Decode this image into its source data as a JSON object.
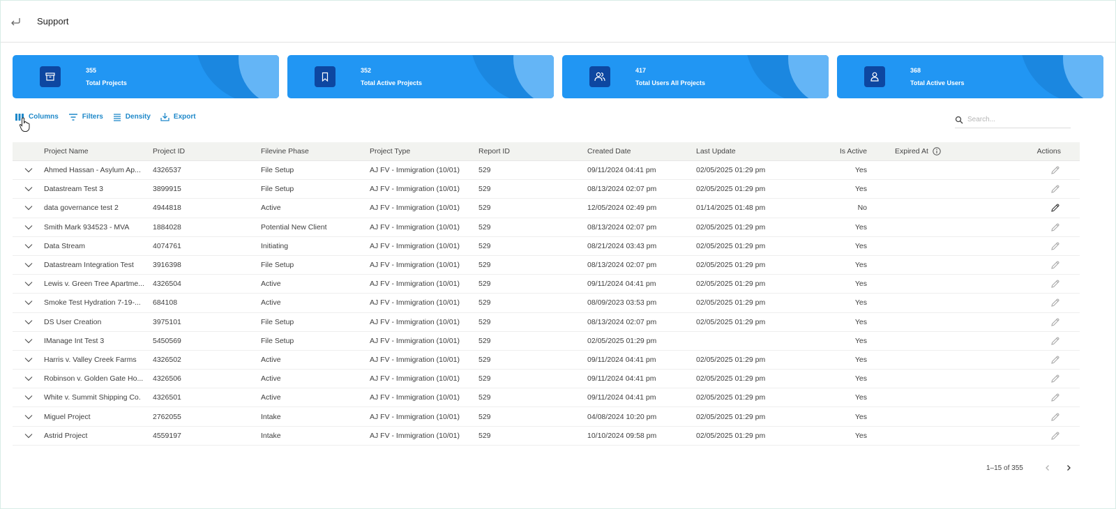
{
  "header": {
    "title": "Support"
  },
  "stats": [
    {
      "value": "355",
      "label": "Total Projects",
      "icon": "archive-icon"
    },
    {
      "value": "352",
      "label": "Total Active Projects",
      "icon": "bookmark-icon"
    },
    {
      "value": "417",
      "label": "Total Users All Projects",
      "icon": "users-icon"
    },
    {
      "value": "368",
      "label": "Total Active Users",
      "icon": "user-icon"
    }
  ],
  "toolbar": {
    "columns_label": "Columns",
    "filters_label": "Filters",
    "density_label": "Density",
    "export_label": "Export",
    "search_placeholder": "Search..."
  },
  "table": {
    "headers": {
      "name": "Project Name",
      "id": "Project ID",
      "phase": "Filevine Phase",
      "type": "Project Type",
      "report": "Report ID",
      "created": "Created Date",
      "updated": "Last Update",
      "active": "Is Active",
      "expired": "Expired At",
      "actions": "Actions"
    },
    "rows": [
      {
        "name": "Ahmed Hassan - Asylum Ap...",
        "id": "4326537",
        "phase": "File Setup",
        "type": "AJ FV - Immigration (10/01)",
        "report": "529",
        "created": "09/11/2024 04:41 pm",
        "updated": "02/05/2025 01:29 pm",
        "active": "Yes"
      },
      {
        "name": "Datastream Test 3",
        "id": "3899915",
        "phase": "File Setup",
        "type": "AJ FV - Immigration (10/01)",
        "report": "529",
        "created": "08/13/2024 02:07 pm",
        "updated": "02/05/2025 01:29 pm",
        "active": "Yes"
      },
      {
        "name": "data governance test 2",
        "id": "4944818",
        "phase": "Active",
        "type": "AJ FV - Immigration (10/01)",
        "report": "529",
        "created": "12/05/2024 02:49 pm",
        "updated": "01/14/2025 01:48 pm",
        "active": "No"
      },
      {
        "name": "Smith Mark 934523 - MVA",
        "id": "1884028",
        "phase": "Potential New Client",
        "type": "AJ FV - Immigration (10/01)",
        "report": "529",
        "created": "08/13/2024 02:07 pm",
        "updated": "02/05/2025 01:29 pm",
        "active": "Yes"
      },
      {
        "name": "Data Stream",
        "id": "4074761",
        "phase": "Initiating",
        "type": "AJ FV - Immigration (10/01)",
        "report": "529",
        "created": "08/21/2024 03:43 pm",
        "updated": "02/05/2025 01:29 pm",
        "active": "Yes"
      },
      {
        "name": "Datastream Integration Test",
        "id": "3916398",
        "phase": "File Setup",
        "type": "AJ FV - Immigration (10/01)",
        "report": "529",
        "created": "08/13/2024 02:07 pm",
        "updated": "02/05/2025 01:29 pm",
        "active": "Yes"
      },
      {
        "name": "Lewis v. Green Tree Apartme...",
        "id": "4326504",
        "phase": "Active",
        "type": "AJ FV - Immigration (10/01)",
        "report": "529",
        "created": "09/11/2024 04:41 pm",
        "updated": "02/05/2025 01:29 pm",
        "active": "Yes"
      },
      {
        "name": "Smoke Test Hydration 7-19-...",
        "id": "684108",
        "phase": "Active",
        "type": "AJ FV - Immigration (10/01)",
        "report": "529",
        "created": "08/09/2023 03:53 pm",
        "updated": "02/05/2025 01:29 pm",
        "active": "Yes"
      },
      {
        "name": "DS User Creation",
        "id": "3975101",
        "phase": "File Setup",
        "type": "AJ FV - Immigration (10/01)",
        "report": "529",
        "created": "08/13/2024 02:07 pm",
        "updated": "02/05/2025 01:29 pm",
        "active": "Yes"
      },
      {
        "name": "IManage Int Test 3",
        "id": "5450569",
        "phase": "File Setup",
        "type": "AJ FV - Immigration (10/01)",
        "report": "529",
        "created": "02/05/2025 01:29 pm",
        "updated": "",
        "active": "Yes"
      },
      {
        "name": "Harris v. Valley Creek Farms",
        "id": "4326502",
        "phase": "Active",
        "type": "AJ FV - Immigration (10/01)",
        "report": "529",
        "created": "09/11/2024 04:41 pm",
        "updated": "02/05/2025 01:29 pm",
        "active": "Yes"
      },
      {
        "name": "Robinson v. Golden Gate Ho...",
        "id": "4326506",
        "phase": "Active",
        "type": "AJ FV - Immigration (10/01)",
        "report": "529",
        "created": "09/11/2024 04:41 pm",
        "updated": "02/05/2025 01:29 pm",
        "active": "Yes"
      },
      {
        "name": "White v. Summit Shipping Co.",
        "id": "4326501",
        "phase": "Active",
        "type": "AJ FV - Immigration (10/01)",
        "report": "529",
        "created": "09/11/2024 04:41 pm",
        "updated": "02/05/2025 01:29 pm",
        "active": "Yes"
      },
      {
        "name": "Miguel Project",
        "id": "2762055",
        "phase": "Intake",
        "type": "AJ FV - Immigration (10/01)",
        "report": "529",
        "created": "04/08/2024 10:20 pm",
        "updated": "02/05/2025 01:29 pm",
        "active": "Yes"
      },
      {
        "name": "Astrid Project",
        "id": "4559197",
        "phase": "Intake",
        "type": "AJ FV - Immigration (10/01)",
        "report": "529",
        "created": "10/10/2024 09:58 pm",
        "updated": "02/05/2025 01:29 pm",
        "active": "Yes"
      }
    ]
  },
  "pagination": {
    "range": "1–15 of 355"
  },
  "colors": {
    "accent": "#2196f3",
    "icon_bg": "#0d47a1",
    "link": "#1e88c9"
  }
}
